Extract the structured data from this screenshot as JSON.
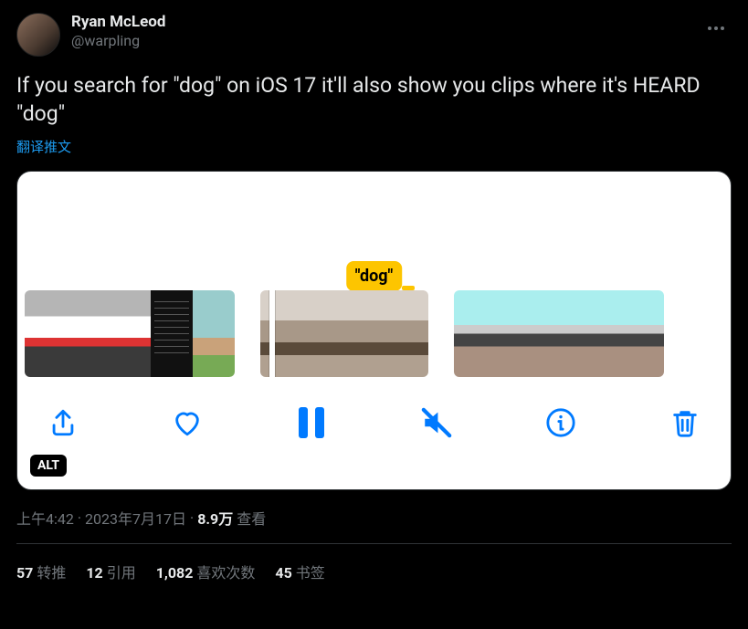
{
  "author": {
    "display_name": "Ryan McLeod",
    "handle": "@warpling"
  },
  "tweet_text": "If you search for \"dog\" on iOS 17 it'll also show you clips where it's HEARD \"dog\"",
  "translate_label": "翻译推文",
  "media": {
    "search_pill": "\"dog\"",
    "alt_badge": "ALT"
  },
  "meta": {
    "time": "上午4:42",
    "date": "2023年7月17日",
    "views_count": "8.9万",
    "views_label": "查看",
    "sep": " · "
  },
  "stats": {
    "retweets": {
      "count": "57",
      "label": "转推"
    },
    "quotes": {
      "count": "12",
      "label": "引用"
    },
    "likes": {
      "count": "1,082",
      "label": "喜欢次数"
    },
    "bookmarks": {
      "count": "45",
      "label": "书签"
    }
  }
}
